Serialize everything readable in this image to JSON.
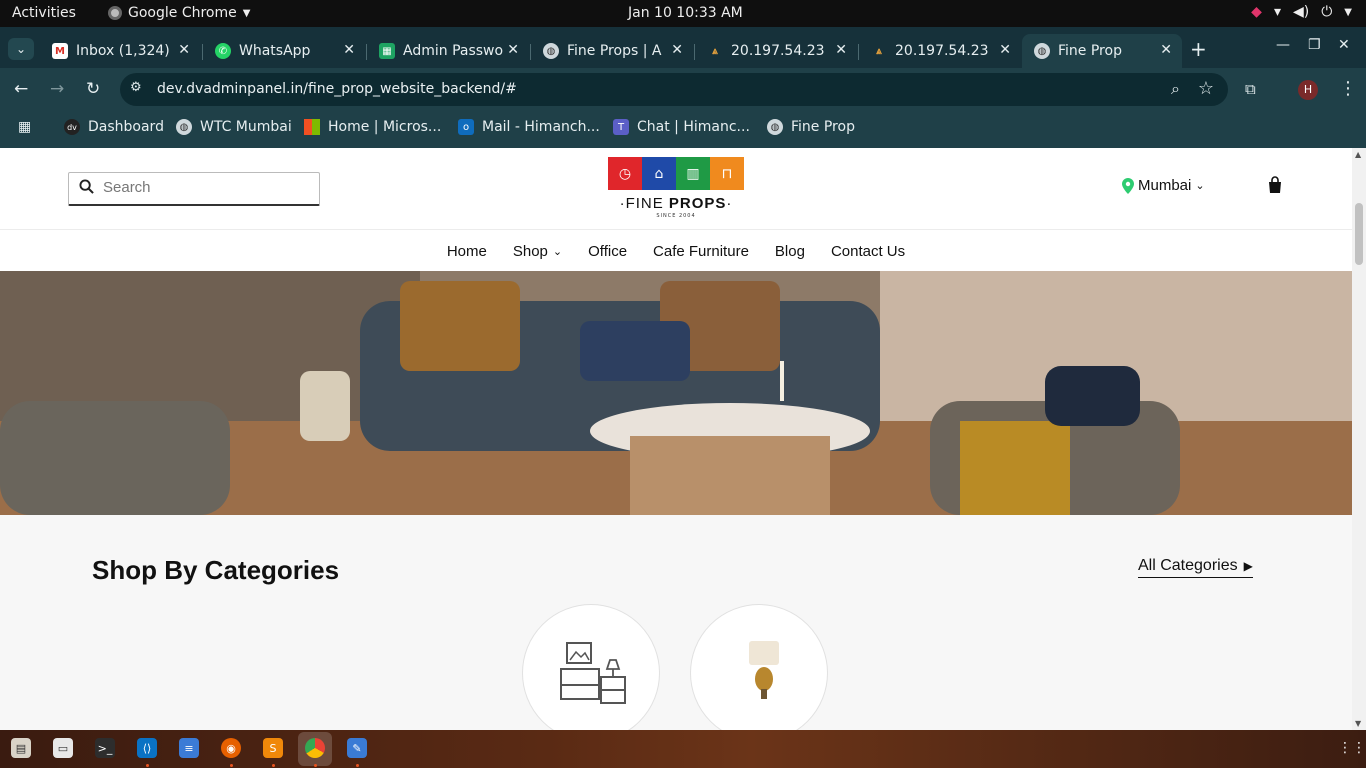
{
  "system": {
    "activities": "Activities",
    "app_name": "Google Chrome",
    "clock": "Jan 10  10:33 AM"
  },
  "tabs": [
    {
      "title": "Inbox (1,324)",
      "icon": "gmail-icon"
    },
    {
      "title": "WhatsApp",
      "icon": "whatsapp-icon"
    },
    {
      "title": "Admin Passwo",
      "icon": "sheets-icon"
    },
    {
      "title": "Fine Props | A",
      "icon": "globe-icon"
    },
    {
      "title": "20.197.54.23",
      "icon": "server-icon"
    },
    {
      "title": "20.197.54.23",
      "icon": "server-icon"
    },
    {
      "title": "Fine Prop",
      "icon": "globe-icon",
      "active": true
    }
  ],
  "address_bar": {
    "url": "dev.dvadminpanel.in/fine_prop_website_backend/#"
  },
  "bookmarks": [
    {
      "label": "Dashboard",
      "icon": "dv-icon"
    },
    {
      "label": "WTC Mumbai",
      "icon": "globe-icon"
    },
    {
      "label": "Home | Micros...",
      "icon": "microsoft-icon"
    },
    {
      "label": "Mail - Himanch...",
      "icon": "outlook-icon"
    },
    {
      "label": "Chat | Himanc...",
      "icon": "teams-icon"
    },
    {
      "label": "Fine Prop",
      "icon": "globe-icon"
    }
  ],
  "site": {
    "search_placeholder": "Search",
    "logo_text_light": "FINE",
    "logo_text_bold": "PROPS",
    "logo_since": "SINCE 2004",
    "location": "Mumbai",
    "nav": [
      "Home",
      "Shop",
      "Office",
      "Cafe Furniture",
      "Blog",
      "Contact Us"
    ],
    "categories_title": "Shop By Categories",
    "all_categories": "All Categories"
  },
  "colors": {
    "tabstrip": "#16313a",
    "toolbar": "#1f4048",
    "logo_red": "#e0262b",
    "logo_blue": "#1f4aa8",
    "logo_green": "#1f9a45",
    "logo_orange": "#f08a1e",
    "pin_green": "#2ecc71"
  }
}
